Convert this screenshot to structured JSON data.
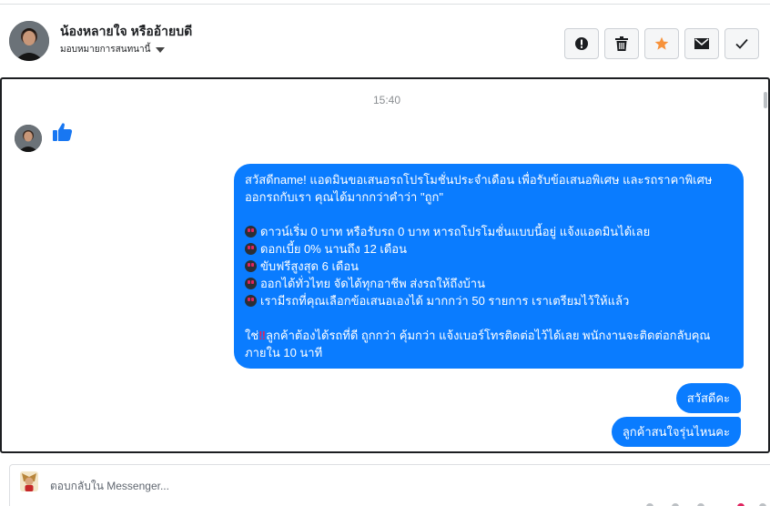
{
  "header": {
    "contact_name": "น้องหลายใจ หรืออ้ายบดี",
    "assign_label": "มอบหมายการสนทนานี้"
  },
  "actions": [
    {
      "name": "mark-spam-button",
      "icon": "exclamation-icon"
    },
    {
      "name": "delete-button",
      "icon": "trash-icon"
    },
    {
      "name": "star-button",
      "icon": "star-icon",
      "color": "#f7923b"
    },
    {
      "name": "mark-unread-button",
      "icon": "envelope-icon"
    },
    {
      "name": "done-button",
      "icon": "check-icon"
    }
  ],
  "conversation": {
    "timestamp": "15:40",
    "like_icon": "thumbs-up-icon",
    "accent_color": "#0a7cff",
    "messages": {
      "main": {
        "intro": "สวัสดีname! แอดมินขอเสนอรถโปรโมชั่นประจำเดือน เพื่อรับข้อเสนอพิเศษ และรถราคาพิเศษ ออกรถกับเรา คุณได้มากกว่าคำว่า \"ถูก\"",
        "bullets": [
          "ดาวน์เริ่ม 0 บาท หรือรับรถ 0 บาท หารถโปรโมชั่นแบบนี้อยู่ แจ้งแอดมินได้เลย",
          "ดอกเบี้ย 0% นานถึง 12 เดือน",
          "ขับฟรีสูงสุด 6 เดือน",
          "ออกได้ทั่วไทย จัดได้ทุกอาชีพ ส่งรถให้ถึงบ้าน",
          "เรามีรถที่คุณเลือกข้อเสนอเองได้ มากกว่า 50 รายการ เราเตรียมไว้ให้แล้ว"
        ],
        "closing_prefix": "ใช่",
        "closing_mark": "‼",
        "closing_rest": "ลูกค้าต้องได้รถที่ดี ถูกกว่า คุ้มกว่า แจ้งเบอร์โทรติดต่อไว้ได้เลย พนักงานจะติดต่อกลับคุณภายใน 10 นาที"
      },
      "reply_1": "สวัสดีคะ",
      "reply_2": "ลูกค้าสนใจรุ่นไหนคะ"
    }
  },
  "composer": {
    "placeholder": "ตอบกลับใน Messenger..."
  }
}
